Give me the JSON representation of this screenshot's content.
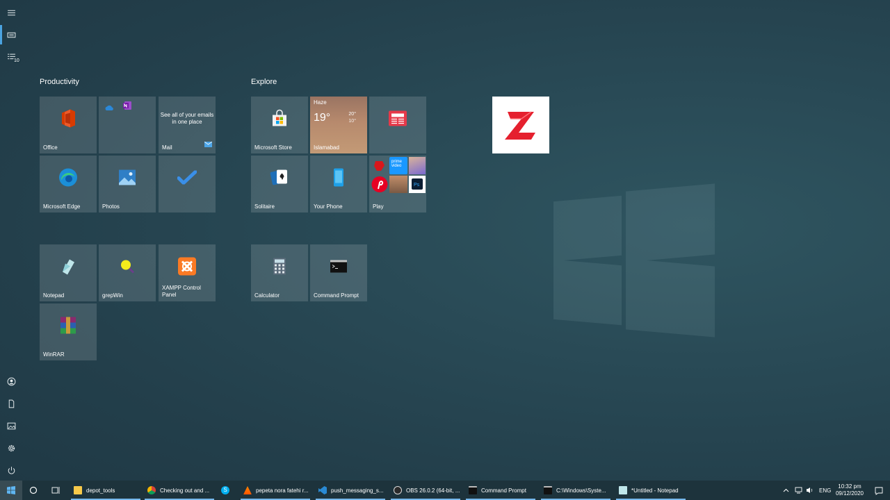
{
  "colors": {
    "accent": "#4ba3e0",
    "tile_bg": "rgba(255,255,255,0.14)",
    "taskbar_bg": "#1d333c"
  },
  "rail": {
    "items": [
      "hamburger-menu-icon",
      "tiles-icon",
      "all-apps-icon",
      "user-icon",
      "documents-icon",
      "pictures-icon",
      "settings-icon",
      "power-icon"
    ],
    "all_apps_badge": "10"
  },
  "groups": {
    "productivity": {
      "title": "Productivity"
    },
    "explore": {
      "title": "Explore"
    }
  },
  "tiles": {
    "office": "Office",
    "mail": {
      "label": "Mail",
      "promo": "See all of your emails in one place"
    },
    "edge": "Microsoft Edge",
    "photos": "Photos",
    "store": "Microsoft Store",
    "weather": {
      "condition": "Haze",
      "temp": "19°",
      "high": "20°",
      "low": "10°",
      "city": "Islamabad"
    },
    "solitaire": "Solitaire",
    "your_phone": "Your Phone",
    "play": "Play",
    "notepad": "Notepad",
    "grepwin": "grepWin",
    "xampp": "XAMPP Control Panel",
    "calculator": "Calculator",
    "cmd": "Command Prompt",
    "winrar": "WinRAR",
    "play_prime": "prime video"
  },
  "taskbar": {
    "apps": [
      {
        "label": "depot_tools"
      },
      {
        "label": "Checking out and ..."
      },
      {
        "label": ""
      },
      {
        "label": "pepeta nora fatehi r..."
      },
      {
        "label": "push_messaging_s..."
      },
      {
        "label": "OBS 26.0.2 (64-bit, ..."
      },
      {
        "label": "Command Prompt"
      },
      {
        "label": "C:\\Windows\\Syste..."
      },
      {
        "label": "*Untitled - Notepad"
      }
    ],
    "language": "ENG",
    "time": "10:32 pm",
    "date": "09/12/2020"
  }
}
